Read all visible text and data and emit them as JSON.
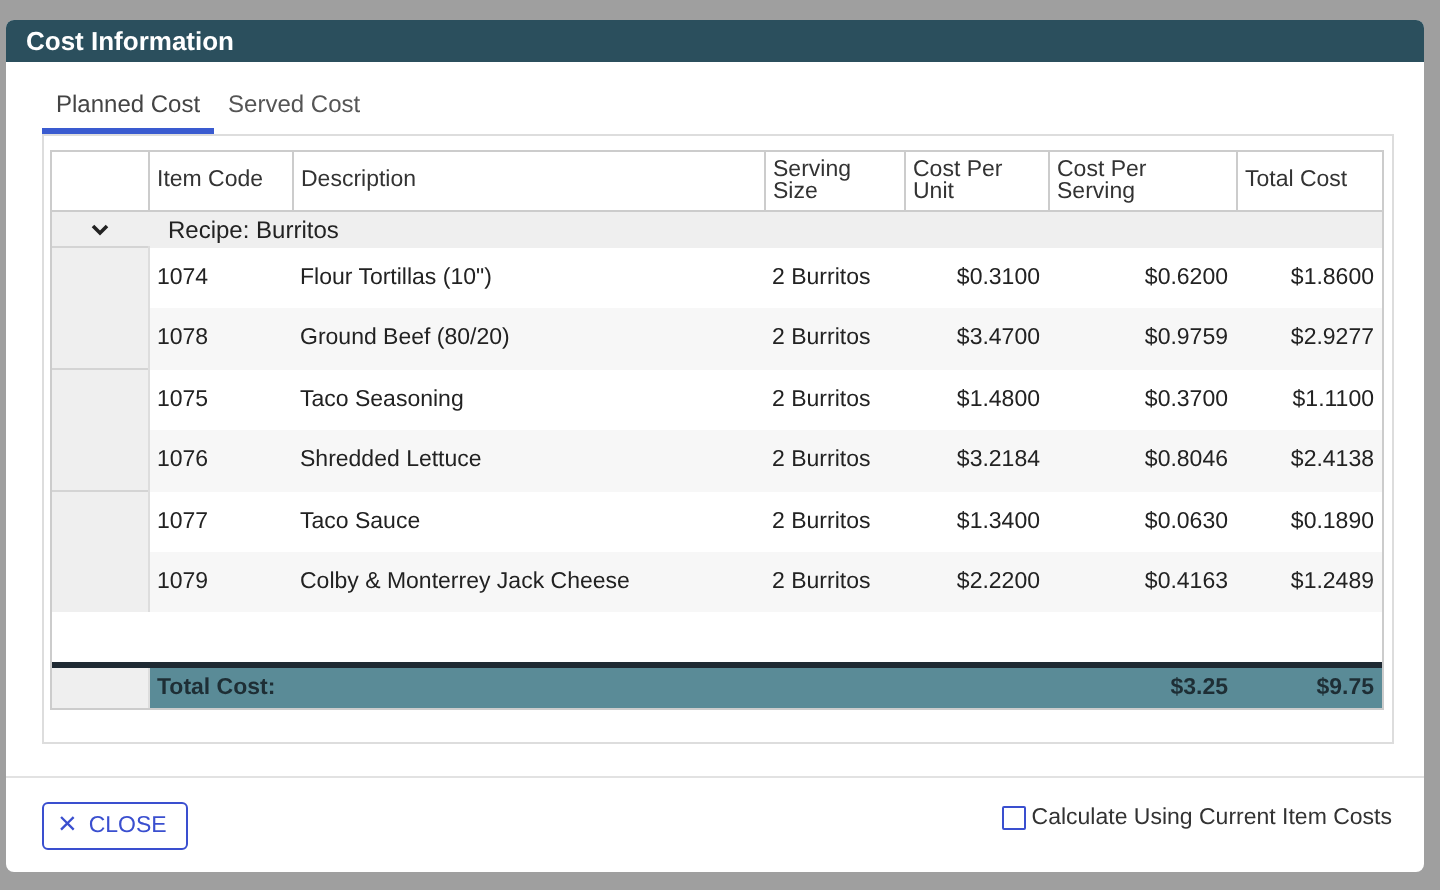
{
  "dialog": {
    "title": "Cost Information"
  },
  "tabs": [
    {
      "label": "Planned Cost",
      "selected": true
    },
    {
      "label": "Served Cost",
      "selected": false
    }
  ],
  "table": {
    "columns": [
      "Item Code",
      "Description",
      "Serving Size",
      "Cost Per Unit",
      "Cost Per Serving",
      "Total Cost"
    ],
    "group": {
      "label": "Recipe: Burritos",
      "expanded": true,
      "rows": [
        {
          "item_code": "1074",
          "description": "Flour Tortillas (10\")",
          "serving_size": "2 Burritos",
          "cost_per_unit": "$0.3100",
          "cost_per_serving": "$0.6200",
          "total_cost": "$1.8600"
        },
        {
          "item_code": "1078",
          "description": "Ground Beef (80/20)",
          "serving_size": "2 Burritos",
          "cost_per_unit": "$3.4700",
          "cost_per_serving": "$0.9759",
          "total_cost": "$2.9277"
        },
        {
          "item_code": "1075",
          "description": "Taco Seasoning",
          "serving_size": "2 Burritos",
          "cost_per_unit": "$1.4800",
          "cost_per_serving": "$0.3700",
          "total_cost": "$1.1100"
        },
        {
          "item_code": "1076",
          "description": "Shredded Lettuce",
          "serving_size": "2 Burritos",
          "cost_per_unit": "$3.2184",
          "cost_per_serving": "$0.8046",
          "total_cost": "$2.4138"
        },
        {
          "item_code": "1077",
          "description": "Taco Sauce",
          "serving_size": "2 Burritos",
          "cost_per_unit": "$1.3400",
          "cost_per_serving": "$0.0630",
          "total_cost": "$0.1890"
        },
        {
          "item_code": "1079",
          "description": "Colby & Monterrey Jack Cheese",
          "serving_size": "2 Burritos",
          "cost_per_unit": "$2.2200",
          "cost_per_serving": "$0.4163",
          "total_cost": "$1.2489"
        }
      ]
    },
    "footer": {
      "label": "Total Cost:",
      "cost_per_serving": "$3.25",
      "total_cost": "$9.75"
    }
  },
  "close_button": {
    "icon": "×",
    "label": "CLOSE"
  },
  "checkbox": {
    "label": "Calculate Using Current Item Costs",
    "checked": false
  }
}
